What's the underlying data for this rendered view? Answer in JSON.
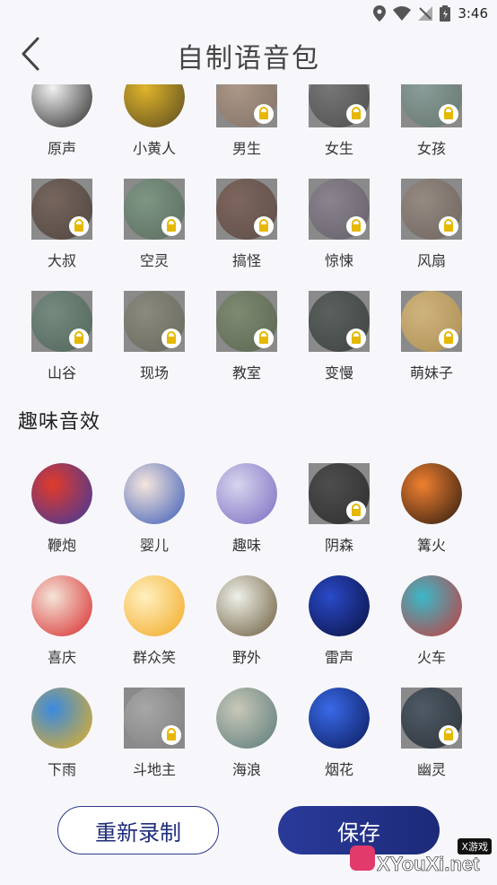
{
  "status_bar": {
    "time": "3:46"
  },
  "header": {
    "title": "自制语音包"
  },
  "voice_pack": [
    {
      "label": "原声",
      "locked": false,
      "c1": "#f2f2f2",
      "c2": "#2a2a2a",
      "icon": "person-silhouette-icon"
    },
    {
      "label": "小黄人",
      "locked": false,
      "c1": "#e0b52a",
      "c2": "#5a4a20",
      "icon": "minion-icon"
    },
    {
      "label": "男生",
      "locked": true,
      "c1": "#b89a86",
      "c2": "#7c6a5a",
      "icon": "man-icon"
    },
    {
      "label": "女生",
      "locked": true,
      "c1": "#707070",
      "c2": "#3a3a3a",
      "icon": "woman-icon"
    },
    {
      "label": "女孩",
      "locked": true,
      "c1": "#8aa39c",
      "c2": "#5a6e68",
      "icon": "girl-icon"
    },
    {
      "label": "大叔",
      "locked": true,
      "c1": "#6f5a4e",
      "c2": "#3e3029",
      "icon": "uncle-icon"
    },
    {
      "label": "空灵",
      "locked": true,
      "c1": "#7a9a82",
      "c2": "#4b6152",
      "icon": "ethereal-icon"
    },
    {
      "label": "搞怪",
      "locked": true,
      "c1": "#7a5a4e",
      "c2": "#4e3a33",
      "icon": "monster-icon"
    },
    {
      "label": "惊悚",
      "locked": true,
      "c1": "#8a8290",
      "c2": "#59515f",
      "icon": "ghost-face-icon"
    },
    {
      "label": "风扇",
      "locked": true,
      "c1": "#9a8a80",
      "c2": "#65584f",
      "icon": "pinwheel-icon"
    },
    {
      "label": "山谷",
      "locked": true,
      "c1": "#6f8a7c",
      "c2": "#3f5a4c",
      "icon": "valley-icon"
    },
    {
      "label": "现场",
      "locked": true,
      "c1": "#8a8a7a",
      "c2": "#5c5c4e",
      "icon": "live-crowd-icon"
    },
    {
      "label": "教室",
      "locked": true,
      "c1": "#7a8a6a",
      "c2": "#4a5a3e",
      "icon": "classroom-icon"
    },
    {
      "label": "变慢",
      "locked": true,
      "c1": "#4a5350",
      "c2": "#262c2a",
      "icon": "slow-icon"
    },
    {
      "label": "萌妹子",
      "locked": true,
      "c1": "#e6c27a",
      "c2": "#b89040",
      "icon": "cute-girl-icon"
    }
  ],
  "section_title": "趣味音效",
  "fun_effects": [
    {
      "label": "鞭炮",
      "locked": false,
      "c1": "#e23a2a",
      "c2": "#3a3aa0",
      "icon": "firecracker-icon"
    },
    {
      "label": "婴儿",
      "locked": false,
      "c1": "#f5e6dc",
      "c2": "#3a5ab8",
      "icon": "baby-icon"
    },
    {
      "label": "趣味",
      "locked": false,
      "c1": "#d6d4ee",
      "c2": "#7a6cc0",
      "icon": "funny-box-icon"
    },
    {
      "label": "阴森",
      "locked": true,
      "c1": "#3a3a3a",
      "c2": "#101010",
      "icon": "spooky-icon"
    },
    {
      "label": "篝火",
      "locked": false,
      "c1": "#f08030",
      "c2": "#2a1a10",
      "icon": "bonfire-icon"
    },
    {
      "label": "喜庆",
      "locked": false,
      "c1": "#f4e4d8",
      "c2": "#d82a2a",
      "icon": "lantern-icon"
    },
    {
      "label": "群众笑",
      "locked": false,
      "c1": "#fff0c0",
      "c2": "#f2a820",
      "icon": "laughing-face-icon"
    },
    {
      "label": "野外",
      "locked": false,
      "c1": "#eef0e8",
      "c2": "#6a5a3a",
      "icon": "castle-icon"
    },
    {
      "label": "雷声",
      "locked": false,
      "c1": "#2a4ac8",
      "c2": "#0a1040",
      "icon": "lightning-icon"
    },
    {
      "label": "火车",
      "locked": false,
      "c1": "#3ab8c8",
      "c2": "#c83a3a",
      "icon": "train-icon"
    },
    {
      "label": "下雨",
      "locked": false,
      "c1": "#3a8ae0",
      "c2": "#e8b020",
      "icon": "rain-icon"
    },
    {
      "label": "斗地主",
      "locked": true,
      "c1": "#b0b0b0",
      "c2": "#7a7a7a",
      "icon": "cards-icon"
    },
    {
      "label": "海浪",
      "locked": false,
      "c1": "#c8c8b8",
      "c2": "#5a7a7a",
      "icon": "wave-icon"
    },
    {
      "label": "烟花",
      "locked": false,
      "c1": "#3a6ae8",
      "c2": "#0a1a5a",
      "icon": "fireworks-icon"
    },
    {
      "label": "幽灵",
      "locked": true,
      "c1": "#3a4a5a",
      "c2": "#101820",
      "icon": "ghost-icon"
    }
  ],
  "buttons": {
    "rerecord": "重新录制",
    "save": "保存"
  },
  "watermark": {
    "badge": "X游戏",
    "text": "XYouXi.net"
  }
}
